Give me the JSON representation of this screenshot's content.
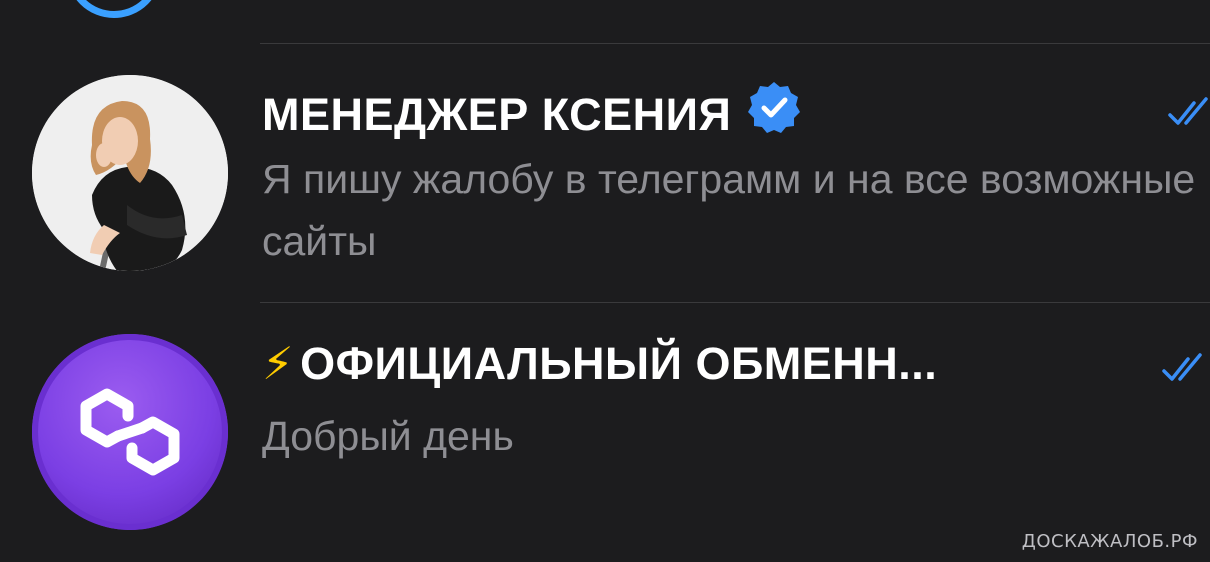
{
  "chats": [
    {
      "title": "МЕНЕДЖЕР КСЕНИЯ",
      "verified": true,
      "preview": "Я пишу жалобу в телеграмм и на все возможные сайты",
      "status": "read",
      "avatar_icon": "person-photo"
    },
    {
      "title_emoji": "⚡",
      "title": "ОФИЦИАЛЬНЫЙ ОБМЕНН...",
      "verified": false,
      "preview": "Добрый день",
      "status": "read",
      "avatar_icon": "polygon-logo"
    }
  ],
  "watermark": "ДОСКАЖАЛОБ.РФ",
  "colors": {
    "background": "#1c1c1e",
    "title": "#ffffff",
    "preview": "#8e8e93",
    "accent": "#3a8ef6",
    "separator": "#3a3a3c",
    "polygon_purple": "#7b3fe4"
  }
}
